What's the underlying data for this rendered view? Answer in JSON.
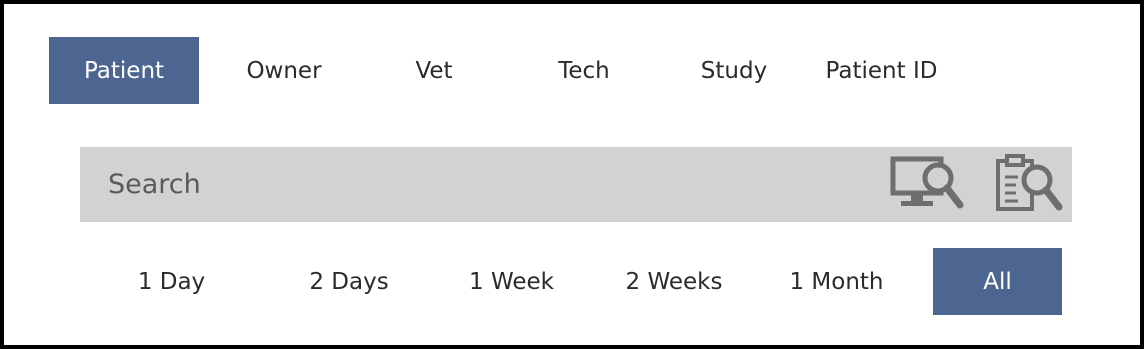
{
  "tabs": [
    {
      "label": "Patient",
      "active": true
    },
    {
      "label": "Owner",
      "active": false
    },
    {
      "label": "Vet",
      "active": false
    },
    {
      "label": "Tech",
      "active": false
    },
    {
      "label": "Study",
      "active": false
    },
    {
      "label": "Patient ID",
      "active": false
    }
  ],
  "search": {
    "placeholder": "Search",
    "value": "",
    "icons": [
      "computer-search-icon",
      "clipboard-search-icon"
    ]
  },
  "ranges": [
    {
      "label": "1 Day",
      "active": false
    },
    {
      "label": "2 Days",
      "active": false
    },
    {
      "label": "1 Week",
      "active": false
    },
    {
      "label": "2 Weeks",
      "active": false
    },
    {
      "label": "1 Month",
      "active": false
    },
    {
      "label": "All",
      "active": true
    }
  ],
  "colors": {
    "accent": "#4d6591",
    "search_bg": "#d2d2d2",
    "icon_gray": "#6e6e6e",
    "text": "#2b2b2b"
  }
}
